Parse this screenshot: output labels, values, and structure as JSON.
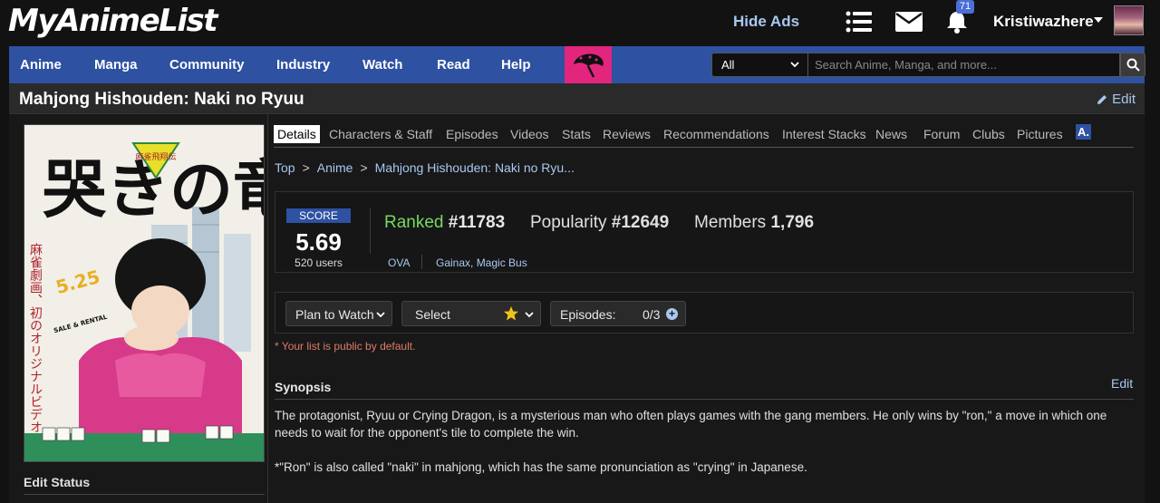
{
  "header": {
    "logo": "MyAnimeList",
    "hide_ads": "Hide Ads",
    "notification_count": "71",
    "username": "Kristiwazhere"
  },
  "nav": {
    "items": [
      "Anime",
      "Manga",
      "Community",
      "Industry",
      "Watch",
      "Read",
      "Help"
    ],
    "search_category": "All",
    "search_placeholder": "Search Anime, Manga, and more..."
  },
  "page": {
    "title": "Mahjong Hishouden: Naki no Ryuu",
    "edit_label": "Edit"
  },
  "sidebar": {
    "edit_status": "Edit Status"
  },
  "tabs": [
    "Details",
    "Characters & Staff",
    "Episodes",
    "Videos",
    "Stats",
    "Reviews",
    "Recommendations",
    "Interest Stacks",
    "News",
    "Forum",
    "Clubs",
    "Pictures"
  ],
  "tab_badge": "A.",
  "breadcrumb": [
    "Top",
    "Anime",
    "Mahjong Hishouden: Naki no Ryu..."
  ],
  "stats": {
    "score_label": "SCORE",
    "score": "5.69",
    "score_users": "520 users",
    "ranked_label": "Ranked",
    "ranked_value": "#11783",
    "popularity_label": "Popularity",
    "popularity_value": "#12649",
    "members_label": "Members",
    "members_value": "1,796",
    "type": "OVA",
    "studios": "Gainax, Magic Bus"
  },
  "list_controls": {
    "status": "Plan to Watch",
    "score_select": "Select",
    "episodes_label": "Episodes:",
    "episodes_value": "0/3",
    "public_note": "* Your list is public by default."
  },
  "synopsis": {
    "heading": "Synopsis",
    "edit_label": "Edit",
    "text": "The protagonist, Ryuu or Crying Dragon, is a mysterious man who often plays games with the gang members. He only wins by \"ron,\" a move in which one needs to wait for the opponent's tile to complete the win.",
    "note": "*\"Ron\" is also called \"naki\" in mahjong, which has the same pronunciation as \"crying\" in Japanese."
  },
  "poster": {
    "title_kanji": "哭きの竜",
    "subtitle_kanji": "麻雀飛翔伝",
    "side_text": "麻雀劇画、初のオリジナルビデオアニメ化!!",
    "release": "5.25",
    "sale_label": "SALE & RENTAL"
  },
  "colors": {
    "nav_bg": "#2e51a2",
    "promo_bg": "#e2267d",
    "ranked_green": "#78d860",
    "link_blue": "#a8c8f0"
  }
}
